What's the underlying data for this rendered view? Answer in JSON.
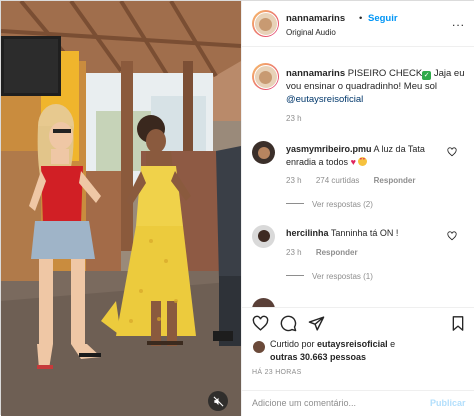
{
  "header": {
    "username": "nannamarins",
    "separator": "•",
    "follow_label": "Seguir",
    "audio_label": "Original Audio",
    "more_label": "..."
  },
  "caption": {
    "username": "nannamarins",
    "text_part1": "PISEIRO CHECK",
    "check_emoji": "✓",
    "text_part2": "Jaja eu vou ensinar o quadradinho! Meu sol",
    "mention": "@eutaysreisoficial",
    "time": "23 h"
  },
  "comments": [
    {
      "username": "yasmymribeiro.pmu",
      "text": "A luz da Tata enradia a todos",
      "time": "23 h",
      "likes": "274 curtidas",
      "reply_label": "Responder",
      "view_replies": "Ver respostas (2)"
    },
    {
      "username": "hercilinha",
      "text": "Tanninha tá ON !",
      "time": "23 h",
      "likes": "",
      "reply_label": "Responder",
      "view_replies": "Ver respostas (1)"
    }
  ],
  "likes": {
    "prefix": "Curtido por",
    "user": "eutaysreisoficial",
    "conj": "e",
    "others": "outras 30.663 pessoas"
  },
  "time_ago": "HÁ 23 HORAS",
  "add_comment": {
    "placeholder": "Adicione um comentário...",
    "publish_label": "Publicar"
  },
  "colors": {
    "accent_link": "#0095f6",
    "mention": "#00376b",
    "muted": "#8e8e8e",
    "publish_disabled": "#b2dffc"
  },
  "icons": {
    "more": "more-horizontal-icon",
    "like": "heart-icon",
    "comment": "comment-icon",
    "share": "paper-plane-icon",
    "save": "bookmark-icon",
    "mute": "speaker-muted-icon"
  }
}
